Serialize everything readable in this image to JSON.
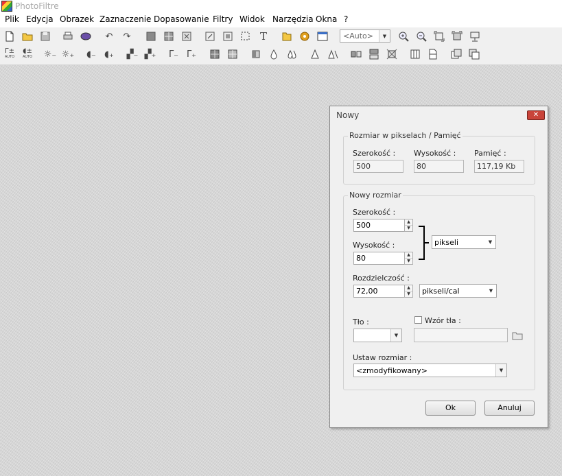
{
  "app": {
    "title": "PhotoFiltre"
  },
  "menu": [
    "Plik",
    "Edycja",
    "Obrazek",
    "Zaznaczenie",
    "Dopasowanie",
    "Filtry",
    "Widok",
    "Narzędzia",
    "Okna",
    "?"
  ],
  "toolbar": {
    "zoom_value": "<Auto>",
    "auto_label": "AUTO"
  },
  "dialog": {
    "title": "Nowy",
    "close_label": "✕",
    "pixel_group": {
      "label": "Rozmiar w pikselach / Pamięć",
      "width_label": "Szerokość :",
      "width_value": "500",
      "height_label": "Wysokość :",
      "height_value": "80",
      "memory_label": "Pamięć :",
      "memory_value": "117,19 Kb"
    },
    "new_size_group": {
      "label": "Nowy rozmiar",
      "width_label": "Szerokość :",
      "width_value": "500",
      "height_label": "Wysokość :",
      "height_value": "80",
      "unit_value": "pikseli",
      "resolution_label": "Rozdzielczość :",
      "resolution_value": "72,00",
      "resolution_unit_value": "pikseli/cal",
      "background_label": "Tło :",
      "background_color": "#ffffff",
      "pattern_label": "Wzór tła :",
      "pattern_value": "",
      "preset_label": "Ustaw rozmiar :",
      "preset_value": "<zmodyfikowany>"
    },
    "ok_label": "Ok",
    "cancel_label": "Anuluj"
  }
}
